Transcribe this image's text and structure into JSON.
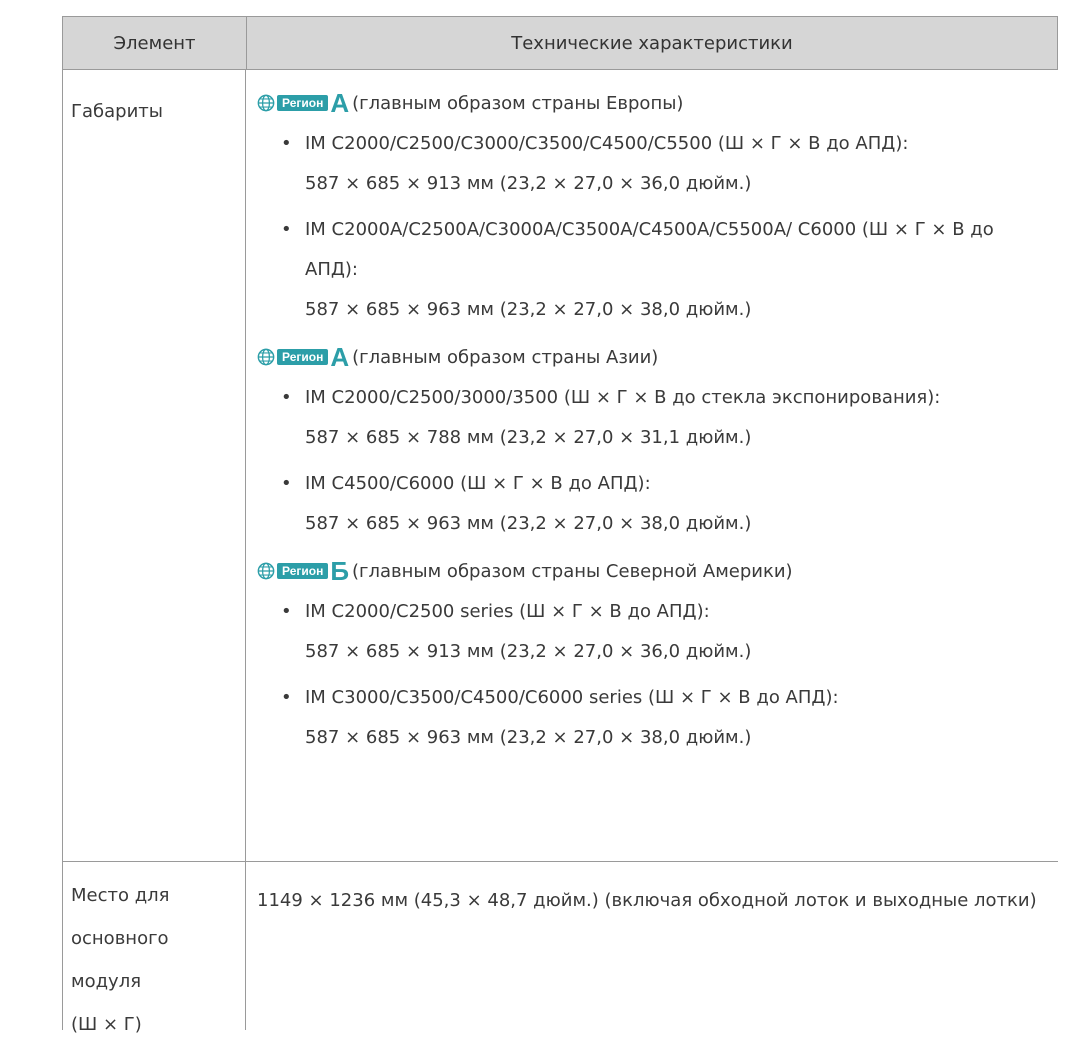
{
  "table": {
    "header": {
      "col1": "Элемент",
      "col2": "Технические характеристики"
    },
    "rows": [
      {
        "label": "Габариты",
        "groups": [
          {
            "badge": "Регион",
            "letter": "A",
            "note": "(главным образом страны Европы)",
            "items": [
              {
                "name": "IM C2000/C2500/C3000/C3500/C4500/C5500 (Ш × Г × В до АПД):",
                "dims": "587 × 685 × 913 мм (23,2 × 27,0 × 36,0 дюйм.)"
              },
              {
                "name": "IM C2000A/C2500A/C3000A/C3500A/C4500A/C5500A/ C6000 (Ш × Г × В до АПД):",
                "dims": "587 × 685 × 963 мм (23,2 × 27,0 × 38,0 дюйм.)"
              }
            ]
          },
          {
            "badge": "Регион",
            "letter": "A",
            "note": "(главным образом страны Азии)",
            "items": [
              {
                "name": "IM C2000/C2500/3000/3500 (Ш × Г × В до стекла экспонирования):",
                "dims": "587 × 685 × 788 мм (23,2 × 27,0 × 31,1 дюйм.)"
              },
              {
                "name": "IM C4500/C6000 (Ш × Г × В до АПД):",
                "dims": "587 × 685 × 963 мм (23,2 × 27,0 × 38,0 дюйм.)"
              }
            ]
          },
          {
            "badge": "Регион",
            "letter": "Б",
            "note": "(главным образом страны Северной Америки)",
            "items": [
              {
                "name": "IM C2000/C2500 series (Ш × Г × В до АПД):",
                "dims": "587 × 685 × 913 мм (23,2 × 27,0 × 36,0 дюйм.)"
              },
              {
                "name": "IM C3000/C3500/C4500/C6000 series (Ш × Г × В до АПД):",
                "dims": "587 × 685 × 963 мм (23,2 × 27,0 × 38,0 дюйм.)"
              }
            ]
          }
        ]
      },
      {
        "label_lines": [
          "Место для",
          "основного модуля",
          "(Ш × Г)"
        ],
        "text": "1149 × 1236 мм (45,3 × 48,7 дюйм.) (включая обходной лоток и выходные лотки)"
      }
    ]
  },
  "colors": {
    "header_bg": "#d6d6d6",
    "accent": "#2c9ea8",
    "border": "#9a9a9a"
  },
  "icons": {
    "region": "globe-icon"
  }
}
